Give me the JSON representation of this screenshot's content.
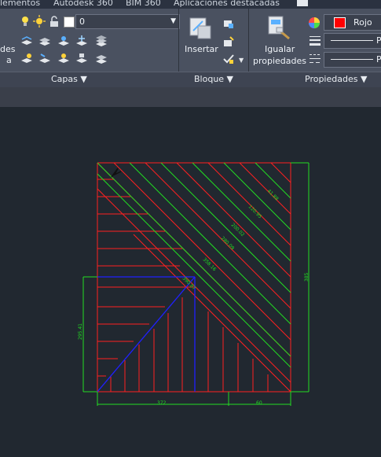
{
  "menubar": {
    "items": [
      "lementos",
      "Autodesk 360",
      "BIM 360",
      "Aplicaciones destacadas"
    ]
  },
  "layers": {
    "current_layer": "0",
    "left_label_1": "des",
    "left_label_2": "a",
    "panel_label": "Capas ▼"
  },
  "block": {
    "insert_label": "Insertar",
    "panel_label": "Bloque ▼"
  },
  "properties": {
    "match_label_1": "Igualar",
    "match_label_2": "propiedades",
    "color_value": "Rojo",
    "color_hex": "#ff0000",
    "linetype_partial": "P",
    "lineweight_partial": "P",
    "panel_label": "Propiedades ▼"
  },
  "drawing": {
    "dim_bottom_left": "372",
    "dim_bottom_right": "60",
    "dim_left": "295.41",
    "dim_right": "385",
    "diag_labels": [
      "41.88",
      "120.95",
      "200.02",
      "280.09",
      "358.16",
      "390.87"
    ],
    "colors": {
      "red": "#ff2020",
      "green": "#22dd22",
      "blue": "#2020ff"
    }
  }
}
